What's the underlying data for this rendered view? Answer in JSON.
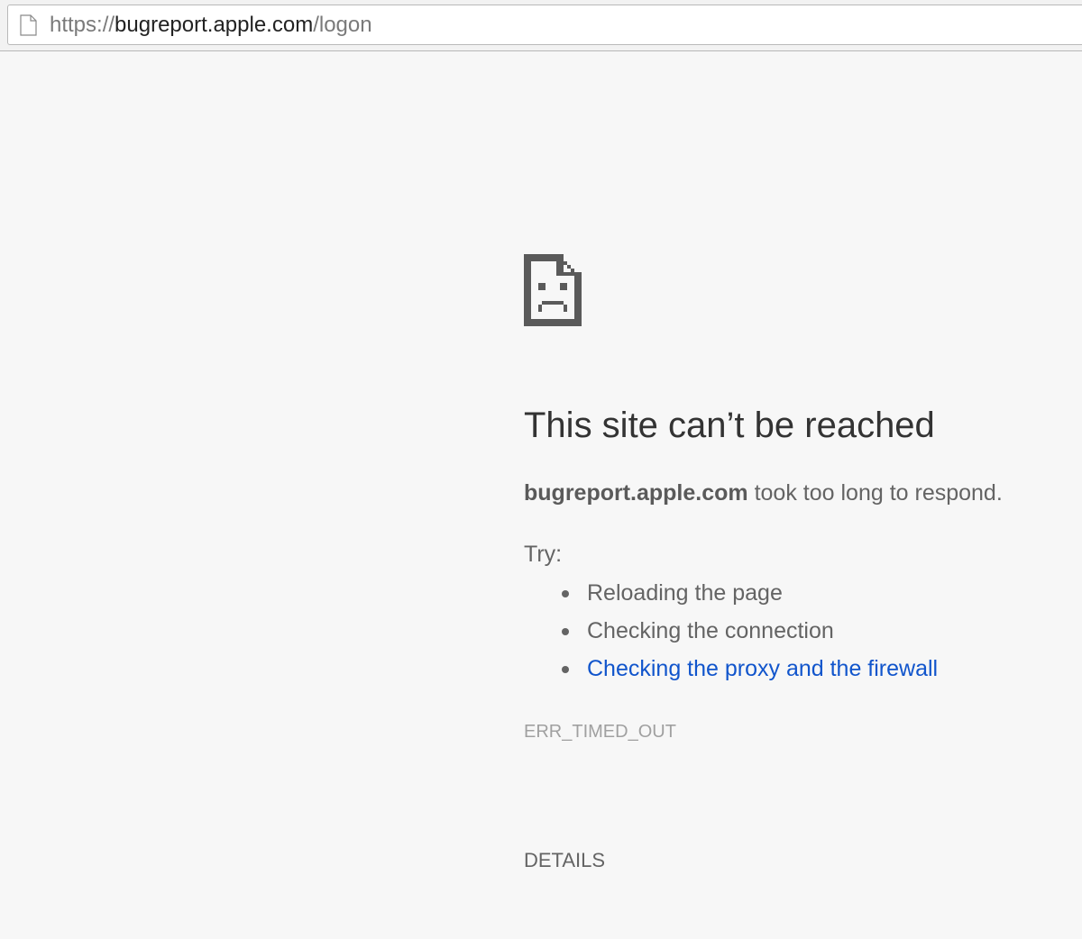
{
  "browser": {
    "url_scheme": "https://",
    "url_host": "bugreport.apple.com",
    "url_path": "/logon",
    "page_icon": "page-icon"
  },
  "error_page": {
    "icon": "sad-page-icon",
    "heading": "This site can’t be reached",
    "summary_host": "bugreport.apple.com",
    "summary_text": " took too long to respond.",
    "try_label": "Try:",
    "suggestions": [
      {
        "label": "Reloading the page",
        "is_link": false
      },
      {
        "label": "Checking the connection",
        "is_link": false
      },
      {
        "label": "Checking the proxy and the firewall",
        "is_link": true
      }
    ],
    "error_code": "ERR_TIMED_OUT",
    "details_label": "DETAILS",
    "link_color": "#1155cc",
    "text_color": "#646464"
  }
}
